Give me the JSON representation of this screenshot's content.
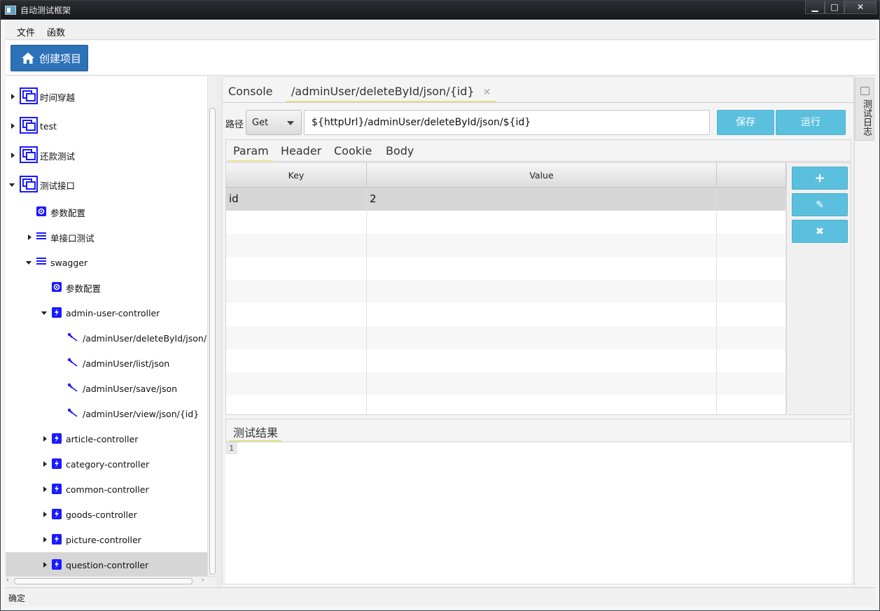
{
  "window": {
    "title": "自动测试框架",
    "minimize": "▁",
    "maximize": "□",
    "close": "✕"
  },
  "menu": {
    "file": "文件",
    "functions": "函数"
  },
  "toolbar": {
    "create_project": "创建项目"
  },
  "tree": [
    {
      "label": "时间穿越",
      "level": 0,
      "arrow": "right",
      "icon": "project-icon"
    },
    {
      "label": "test",
      "level": 0,
      "arrow": "right",
      "icon": "project-icon"
    },
    {
      "label": "还款测试",
      "level": 0,
      "arrow": "right",
      "icon": "project-icon"
    },
    {
      "label": "测试接口",
      "level": 0,
      "arrow": "down",
      "icon": "project-icon"
    },
    {
      "label": "参数配置",
      "level": 1,
      "arrow": "none",
      "icon": "gear-icon"
    },
    {
      "label": "单接口测试",
      "level": 1,
      "arrow": "right",
      "icon": "list-icon"
    },
    {
      "label": "swagger",
      "level": 1,
      "arrow": "down",
      "icon": "list-icon"
    },
    {
      "label": "参数配置",
      "level": 2,
      "arrow": "none",
      "icon": "gear-icon"
    },
    {
      "label": "admin-user-controller",
      "level": 2,
      "arrow": "down",
      "icon": "controller-icon"
    },
    {
      "label": "/adminUser/deleteById/json/{i",
      "level": 3,
      "arrow": "none",
      "icon": "api-icon"
    },
    {
      "label": "/adminUser/list/json",
      "level": 3,
      "arrow": "none",
      "icon": "api-icon"
    },
    {
      "label": "/adminUser/save/json",
      "level": 3,
      "arrow": "none",
      "icon": "api-icon"
    },
    {
      "label": "/adminUser/view/json/{id}",
      "level": 3,
      "arrow": "none",
      "icon": "api-icon"
    },
    {
      "label": "article-controller",
      "level": 2,
      "arrow": "right",
      "icon": "controller-icon"
    },
    {
      "label": "category-controller",
      "level": 2,
      "arrow": "right",
      "icon": "controller-icon"
    },
    {
      "label": "common-controller",
      "level": 2,
      "arrow": "right",
      "icon": "controller-icon"
    },
    {
      "label": "goods-controller",
      "level": 2,
      "arrow": "right",
      "icon": "controller-icon"
    },
    {
      "label": "picture-controller",
      "level": 2,
      "arrow": "right",
      "icon": "controller-icon"
    },
    {
      "label": "question-controller",
      "level": 2,
      "arrow": "right",
      "icon": "controller-icon",
      "selected": true
    }
  ],
  "tabs": {
    "console": "Console",
    "active": "/adminUser/deleteById/json/{id}",
    "close": "✕"
  },
  "request": {
    "path_label": "路径",
    "method": "Get",
    "url": "${httpUrl}/adminUser/deleteById/json/${id}",
    "save": "保存",
    "run": "运行"
  },
  "subtabs": [
    "Param",
    "Header",
    "Cookie",
    "Body"
  ],
  "params": {
    "headers": [
      "Key",
      "Value",
      ""
    ],
    "rows": [
      {
        "key": "id",
        "value": "2"
      }
    ]
  },
  "side_buttons": {
    "add": "+",
    "edit": "✎",
    "delete": "✖"
  },
  "result": {
    "tab": "测试结果",
    "line1": "1"
  },
  "side_panel": {
    "test_log": "测试日志"
  },
  "status": {
    "text": "确定"
  },
  "colors": {
    "primary": "#2d71b8",
    "info": "#5bc0de",
    "tree_icon": "#1a1aff",
    "tab_underline": "#e7e08a"
  }
}
